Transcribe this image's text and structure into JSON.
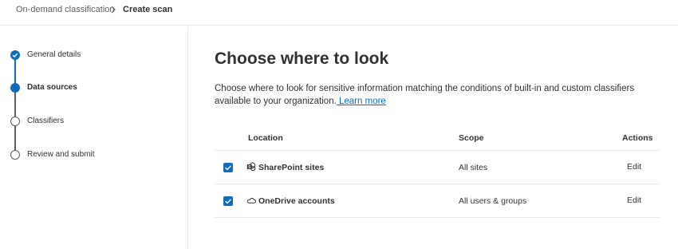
{
  "breadcrumb": {
    "items": [
      {
        "label": "On-demand classification"
      },
      {
        "label": "Create scan"
      }
    ]
  },
  "stepper": {
    "steps": [
      {
        "label": "General details",
        "state": "complete"
      },
      {
        "label": "Data sources",
        "state": "current"
      },
      {
        "label": "Classifiers",
        "state": "future"
      },
      {
        "label": "Review and submit",
        "state": "future"
      }
    ]
  },
  "main": {
    "title": "Choose where to look",
    "description": "Choose where to look for sensitive information matching the conditions of built-in and custom classifiers available to your organization.",
    "learn_more": " Learn more"
  },
  "table": {
    "headers": {
      "location": "Location",
      "scope": "Scope",
      "actions": "Actions"
    },
    "rows": [
      {
        "checked": true,
        "icon": "sharepoint-icon",
        "location": "SharePoint sites",
        "scope": "All sites",
        "action": "Edit"
      },
      {
        "checked": true,
        "icon": "onedrive-icon",
        "location": "OneDrive accounts",
        "scope": "All users & groups",
        "action": "Edit"
      }
    ]
  },
  "colors": {
    "accent": "#0f6cbd",
    "text": "#323130",
    "muted": "#605e5c",
    "divider": "#edebe9"
  }
}
